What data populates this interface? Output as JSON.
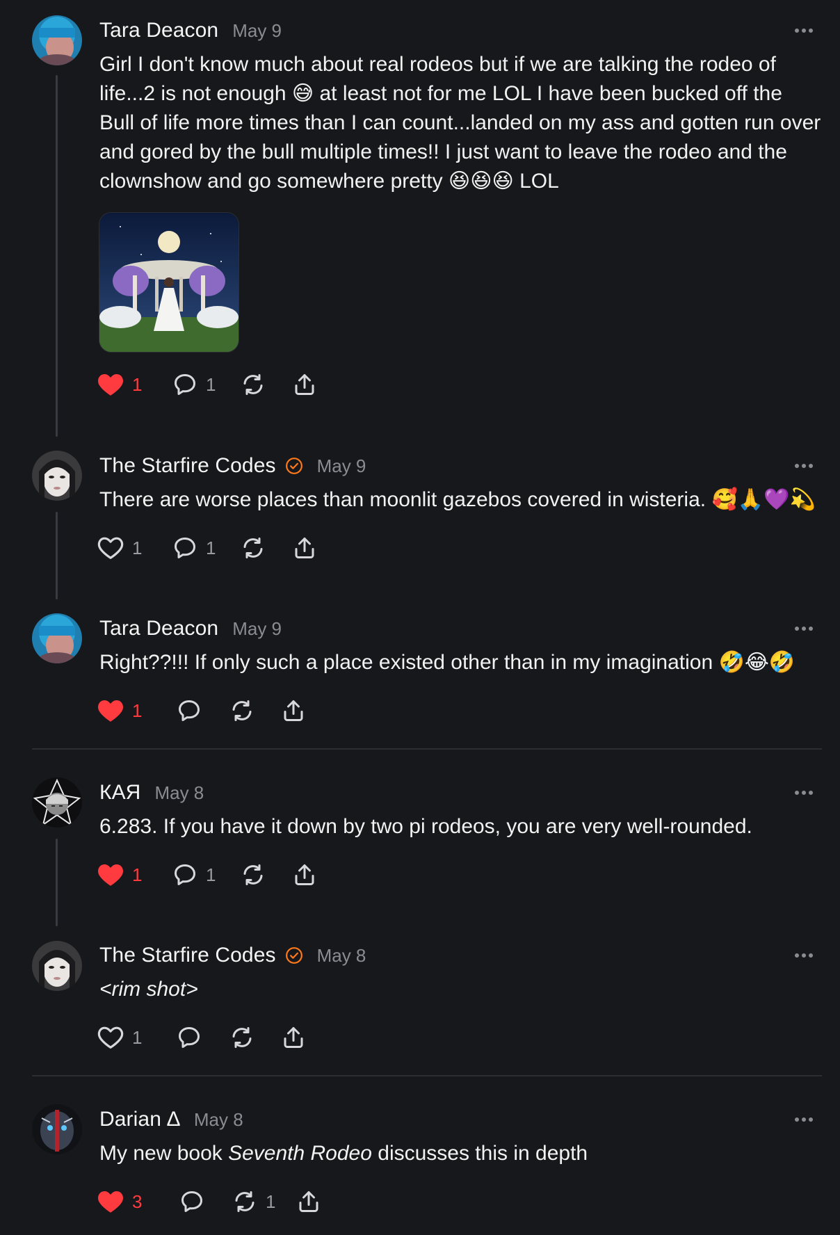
{
  "posts": [
    {
      "author": "Tara Deacon",
      "date": "May 9",
      "text": "Girl I don't know much about real rodeos but if we are talking the rodeo of life...2 is not enough 😅 at least not for me LOL I have been bucked off the Bull of life more times than I can count...landed on my ass and gotten run over and gored by the bull multiple times!! I just want to leave the rodeo and the clownshow and go somewhere pretty 😆😆😆 LOL",
      "has_image": true,
      "liked": true,
      "likes": "1",
      "replies": "1",
      "reposts": ""
    },
    {
      "author": "The Starfire Codes",
      "verified": true,
      "date": "May 9",
      "text": "There are worse places than moonlit gazebos covered in wisteria. 🥰🙏💜💫",
      "liked": false,
      "likes": "1",
      "replies": "1",
      "reposts": ""
    },
    {
      "author": "Tara Deacon",
      "date": "May 9",
      "text": "Right??!!! If only such a place existed other than in my imagination 🤣😂🤣",
      "liked": true,
      "likes": "1",
      "replies": "",
      "reposts": ""
    },
    {
      "author": "КАЯ",
      "date": "May 8",
      "text": "6.283. If you have it down by two pi rodeos, you are very well-rounded.",
      "liked": true,
      "likes": "1",
      "replies": "1",
      "reposts": ""
    },
    {
      "author": "The Starfire Codes",
      "verified": true,
      "date": "May 8",
      "text": "<rim shot>",
      "liked": false,
      "likes": "1",
      "replies": "",
      "reposts": ""
    },
    {
      "author": "Darian ∆",
      "date": "May 8",
      "text_before": "My new book ",
      "text_italic": "Seventh Rodeo",
      "text_after": " discusses this in depth",
      "liked": true,
      "likes": "3",
      "replies": "",
      "reposts": "1"
    }
  ],
  "colors": {
    "background": "#17181b",
    "like_red": "#ff3b40",
    "verified_orange": "#ff7a1a",
    "secondary_text": "#8b8c91"
  },
  "icons": [
    "heart-icon",
    "comment-icon",
    "repost-icon",
    "share-icon",
    "more-icon",
    "verified-icon"
  ]
}
